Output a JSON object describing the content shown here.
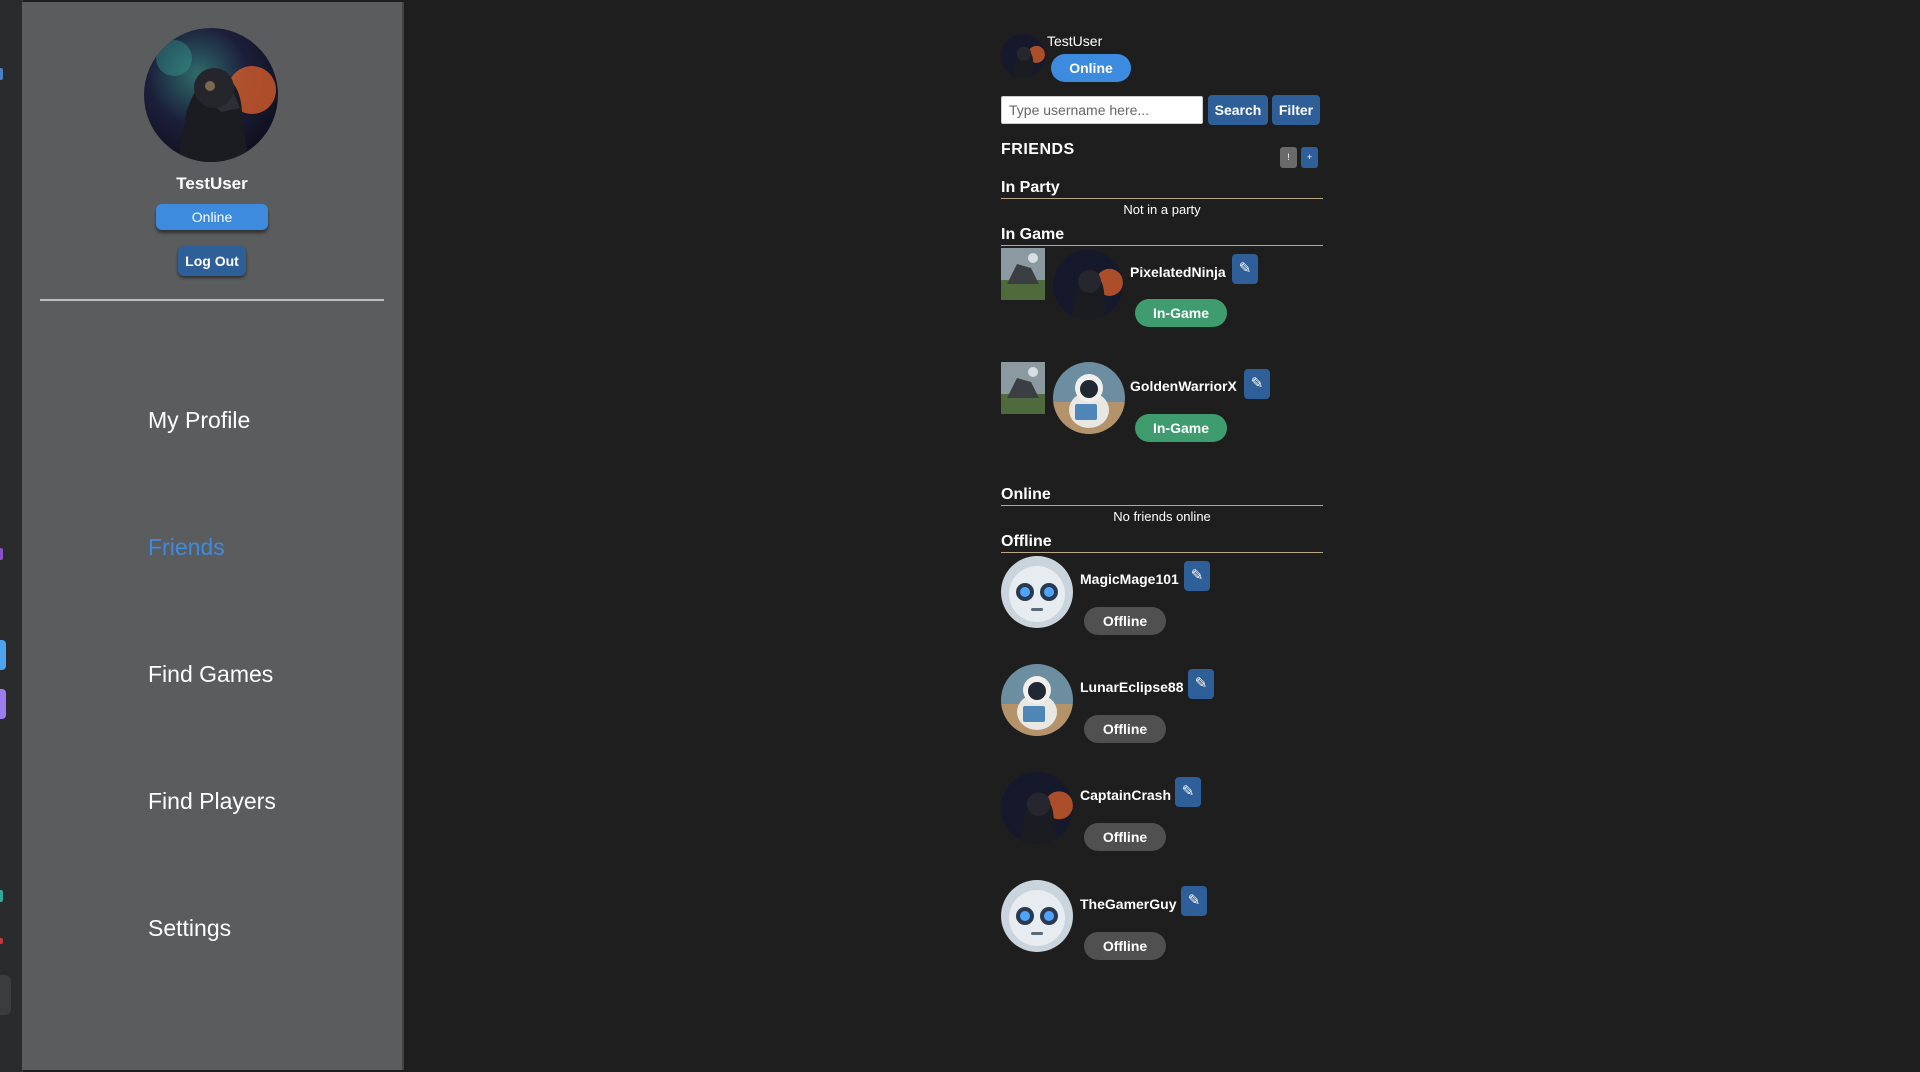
{
  "user": {
    "name": "TestUser",
    "status": "Online"
  },
  "sidebar": {
    "logout_label": "Log Out",
    "nav": [
      {
        "label": "My Profile",
        "active": false
      },
      {
        "label": "Friends",
        "active": true
      },
      {
        "label": "Find Games",
        "active": false
      },
      {
        "label": "Find Players",
        "active": false
      },
      {
        "label": "Settings",
        "active": false
      }
    ]
  },
  "friends_panel": {
    "search_placeholder": "Type username here...",
    "search_label": "Search",
    "filter_label": "Filter",
    "title": "FRIENDS",
    "mini_buttons": [
      "!",
      "+"
    ],
    "sections": {
      "in_party": {
        "label": "In Party",
        "empty": "Not in a party"
      },
      "in_game": {
        "label": "In Game",
        "friends": [
          {
            "name": "PixelatedNinja",
            "status": "In-Game",
            "avatar": "warrior-avatar-icon"
          },
          {
            "name": "GoldenWarriorX",
            "status": "In-Game",
            "avatar": "astronaut-avatar-icon"
          }
        ]
      },
      "online": {
        "label": "Online",
        "empty": "No friends online"
      },
      "offline": {
        "label": "Offline",
        "friends": [
          {
            "name": "MagicMage101",
            "status": "Offline",
            "avatar": "robot-avatar-icon"
          },
          {
            "name": "LunarEclipse88",
            "status": "Offline",
            "avatar": "astronaut-avatar-icon"
          },
          {
            "name": "CaptainCrash",
            "status": "Offline",
            "avatar": "warrior-avatar-icon"
          },
          {
            "name": "TheGamerGuy",
            "status": "Offline",
            "avatar": "robot-avatar-icon"
          }
        ]
      }
    }
  },
  "colors": {
    "accent": "#3d8bdf",
    "button": "#2e5f99",
    "in_game": "#3e9c6f",
    "offline": "#505050",
    "sidebar_bg": "#5b5c5e",
    "main_bg": "#1e1e1e"
  }
}
